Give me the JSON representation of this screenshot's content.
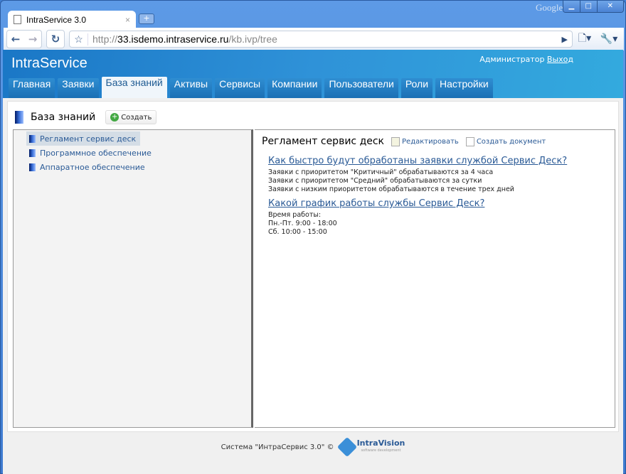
{
  "browser": {
    "tab_title": "IntraService 3.0",
    "brand": "Google",
    "url_prefix": "http://",
    "url_host": "33.isdemo.intraservice.ru",
    "url_path": "/kb.ivp/tree"
  },
  "header": {
    "logo": "IntraService",
    "user": "Администратор",
    "logout": "Выход"
  },
  "menu": [
    "Главная",
    "Заявки",
    "База знаний",
    "Активы",
    "Сервисы",
    "Компании",
    "Пользователи",
    "Роли",
    "Настройки"
  ],
  "page": {
    "title": "База знаний",
    "create_label": "Создать"
  },
  "tree": [
    "Регламент сервис деск",
    "Программное обеспечение",
    "Аппаратное обеспечение"
  ],
  "article": {
    "title": "Регламент сервис деск",
    "edit_label": "Редактировать",
    "create_doc_label": "Создать документ",
    "q1": "Как быстро будут обработаны заявки службой Сервис Деск?",
    "q1_lines": [
      "Заявки с приоритетом \"Критичный\" обрабатываются за 4 часа",
      "Заявки с приоритетом \"Средний\" обрабатываются за сутки",
      "Заявки с низким приоритетом обрабатываются в течение трех дней"
    ],
    "q2": "Какой график работы службы Сервис Деск?",
    "q2_lines": [
      "Время работы:",
      "Пн.-Пт. 9:00 - 18:00",
      "Сб. 10:00 - 15:00"
    ]
  },
  "footer": {
    "text": "Система \"ИнтраСервис 3.0\" ©",
    "logo": "IntraVision",
    "logo_sub": "software development"
  }
}
